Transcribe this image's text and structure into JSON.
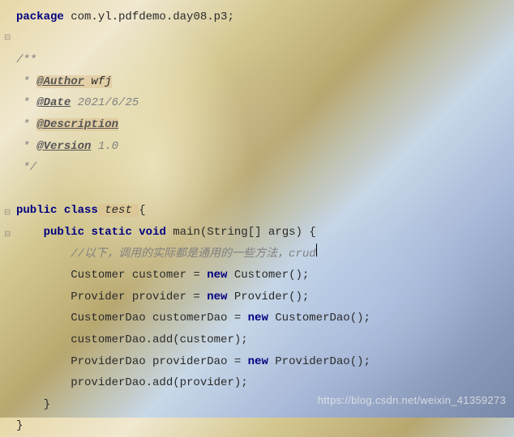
{
  "code": {
    "package_kw": "package",
    "package_name": " com.yl.pdfdemo.day08.p3;",
    "jdoc_open": "/**",
    "jdoc_star": " * ",
    "tag_author": "@Author",
    "val_author": " wfj",
    "tag_date": "@Date",
    "val_date": " 2021/6/25",
    "tag_desc": "@Description",
    "tag_version": "@Version",
    "val_version": " 1.0",
    "jdoc_close": " */",
    "public_kw": "public",
    "class_kw": "class",
    "class_name": " test ",
    "brace_open": "{",
    "static_kw": "static",
    "void_kw": "void",
    "main_name": " main",
    "main_params": "(String[] args) ",
    "comment_line": "//以下，调用的实际都是通用的一些方法，crud",
    "new_kw": "new",
    "l1": "        Customer customer = ",
    "l1b": " Customer();",
    "l2": "        Provider provider = ",
    "l2b": " Provider();",
    "l3": "        CustomerDao customerDao = ",
    "l3b": " CustomerDao();",
    "l4": "        customerDao.add(customer);",
    "l5": "        ProviderDao providerDao = ",
    "l5b": " ProviderDao();",
    "l6": "        providerDao.add(provider);",
    "brace_close_inner": "    }",
    "brace_close_outer": "}"
  },
  "watermark": "https://blog.csdn.net/weixin_41359273"
}
